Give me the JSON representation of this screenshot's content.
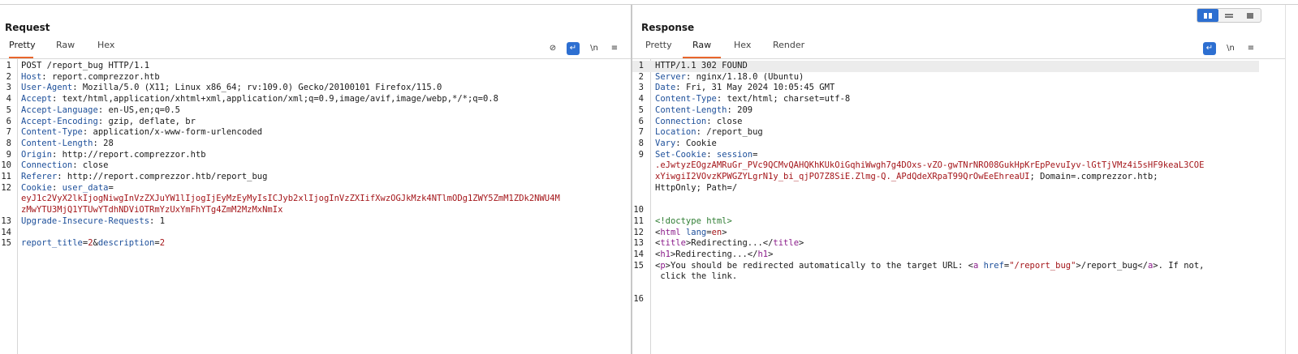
{
  "request": {
    "title": "Request",
    "tabs": [
      "Pretty",
      "Raw",
      "Hex"
    ],
    "active_tab": "Pretty",
    "tools": {
      "hide_label": "⊘",
      "wrap_label": "↵",
      "newline_label": "\\n",
      "menu_label": "≡"
    },
    "lines": [
      {
        "n": "1",
        "parts": [
          {
            "c": "plain",
            "t": "POST /report_bug HTTP/1.1"
          }
        ]
      },
      {
        "n": "2",
        "parts": [
          {
            "c": "k",
            "t": "Host"
          },
          {
            "c": "plain",
            "t": ": report.comprezzor.htb"
          }
        ]
      },
      {
        "n": "3",
        "parts": [
          {
            "c": "k",
            "t": "User-Agent"
          },
          {
            "c": "plain",
            "t": ": Mozilla/5.0 (X11; Linux x86_64; rv:109.0) Gecko/20100101 Firefox/115.0"
          }
        ]
      },
      {
        "n": "4",
        "parts": [
          {
            "c": "k",
            "t": "Accept"
          },
          {
            "c": "plain",
            "t": ": text/html,application/xhtml+xml,application/xml;q=0.9,image/avif,image/webp,*/*;q=0.8"
          }
        ]
      },
      {
        "n": "5",
        "parts": [
          {
            "c": "k",
            "t": "Accept-Language"
          },
          {
            "c": "plain",
            "t": ": en-US,en;q=0.5"
          }
        ]
      },
      {
        "n": "6",
        "parts": [
          {
            "c": "k",
            "t": "Accept-Encoding"
          },
          {
            "c": "plain",
            "t": ": gzip, deflate, br"
          }
        ]
      },
      {
        "n": "7",
        "parts": [
          {
            "c": "k",
            "t": "Content-Type"
          },
          {
            "c": "plain",
            "t": ": application/x-www-form-urlencoded"
          }
        ]
      },
      {
        "n": "8",
        "parts": [
          {
            "c": "k",
            "t": "Content-Length"
          },
          {
            "c": "plain",
            "t": ": 28"
          }
        ]
      },
      {
        "n": "9",
        "parts": [
          {
            "c": "k",
            "t": "Origin"
          },
          {
            "c": "plain",
            "t": ": http://report.comprezzor.htb"
          }
        ]
      },
      {
        "n": "10",
        "parts": [
          {
            "c": "k",
            "t": "Connection"
          },
          {
            "c": "plain",
            "t": ": close"
          }
        ]
      },
      {
        "n": "11",
        "parts": [
          {
            "c": "k",
            "t": "Referer"
          },
          {
            "c": "plain",
            "t": ": http://report.comprezzor.htb/report_bug"
          }
        ]
      },
      {
        "n": "12",
        "parts": [
          {
            "c": "k",
            "t": "Cookie"
          },
          {
            "c": "plain",
            "t": ": "
          },
          {
            "c": "k",
            "t": "user_data"
          },
          {
            "c": "plain",
            "t": "="
          }
        ]
      },
      {
        "n": "",
        "parts": [
          {
            "c": "v",
            "t": "eyJ1c2VyX2lkIjogNiwgInVzZXJuYW1lIjogIjEyMzEyMyIsICJyb2xlIjogInVzZXIifXwzOGJkMzk4NTlmODg1ZWY5ZmM1ZDk2NWU4M"
          }
        ]
      },
      {
        "n": "",
        "parts": [
          {
            "c": "v",
            "t": "zMwYTU3MjQ1YTUwYTdhNDViOTRmYzUxYmFhYTg4ZmM2MzMxNmIx"
          }
        ]
      },
      {
        "n": "13",
        "parts": [
          {
            "c": "k",
            "t": "Upgrade-Insecure-Requests"
          },
          {
            "c": "plain",
            "t": ": 1"
          }
        ]
      },
      {
        "n": "14",
        "parts": []
      },
      {
        "n": "15",
        "parts": [
          {
            "c": "k",
            "t": "report_title"
          },
          {
            "c": "plain",
            "t": "="
          },
          {
            "c": "v",
            "t": "2"
          },
          {
            "c": "plain",
            "t": "&"
          },
          {
            "c": "k",
            "t": "description"
          },
          {
            "c": "plain",
            "t": "="
          },
          {
            "c": "v",
            "t": "2"
          }
        ]
      }
    ]
  },
  "response": {
    "title": "Response",
    "tabs": [
      "Pretty",
      "Raw",
      "Hex",
      "Render"
    ],
    "active_tab": "Raw",
    "tools": {
      "wrap_label": "↵",
      "newline_label": "\\n",
      "menu_label": "≡"
    },
    "lines": [
      {
        "n": "1",
        "parts": [
          {
            "c": "plain",
            "t": "HTTP/1.1 302 FOUND"
          }
        ]
      },
      {
        "n": "2",
        "parts": [
          {
            "c": "k",
            "t": "Server"
          },
          {
            "c": "plain",
            "t": ": nginx/1.18.0 (Ubuntu)"
          }
        ]
      },
      {
        "n": "3",
        "parts": [
          {
            "c": "k",
            "t": "Date"
          },
          {
            "c": "plain",
            "t": ": Fri, 31 May 2024 10:05:45 GMT"
          }
        ]
      },
      {
        "n": "4",
        "parts": [
          {
            "c": "k",
            "t": "Content-Type"
          },
          {
            "c": "plain",
            "t": ": text/html; charset=utf-8"
          }
        ]
      },
      {
        "n": "5",
        "parts": [
          {
            "c": "k",
            "t": "Content-Length"
          },
          {
            "c": "plain",
            "t": ": 209"
          }
        ]
      },
      {
        "n": "6",
        "parts": [
          {
            "c": "k",
            "t": "Connection"
          },
          {
            "c": "plain",
            "t": ": close"
          }
        ]
      },
      {
        "n": "7",
        "parts": [
          {
            "c": "k",
            "t": "Location"
          },
          {
            "c": "plain",
            "t": ": /report_bug"
          }
        ]
      },
      {
        "n": "8",
        "parts": [
          {
            "c": "k",
            "t": "Vary"
          },
          {
            "c": "plain",
            "t": ": Cookie"
          }
        ]
      },
      {
        "n": "9",
        "parts": [
          {
            "c": "k",
            "t": "Set-Cookie"
          },
          {
            "c": "plain",
            "t": ": "
          },
          {
            "c": "k",
            "t": "session"
          },
          {
            "c": "plain",
            "t": "="
          }
        ]
      },
      {
        "n": "",
        "parts": [
          {
            "c": "v",
            "t": ".eJwtyzEOgzAMRuGr_PVc9QCMvQAHQKhKUkOiGqhiWwgh7g4DOxs-vZO-gwTNrNRO08GukHpKrEpPevuIyv-lGtTjVMz4i5sHF9keaL3COE"
          }
        ]
      },
      {
        "n": "",
        "parts": [
          {
            "c": "v",
            "t": "xYiwgiI2VOvzKPWGZYLgrN1y_bi_qjPO7Z8SiE.Zlmg-Q._APdQdeXRpaT99QrOwEeEhreaUI"
          },
          {
            "c": "plain",
            "t": "; Domain=.comprezzor.htb;"
          }
        ]
      },
      {
        "n": "",
        "parts": [
          {
            "c": "plain",
            "t": "HttpOnly; Path=/"
          }
        ]
      },
      {
        "n": "",
        "parts": []
      },
      {
        "n": "10",
        "parts": []
      },
      {
        "n": "11",
        "parts": [
          {
            "c": "c",
            "t": "<!doctype html>"
          }
        ]
      },
      {
        "n": "12",
        "parts": [
          {
            "c": "plain",
            "t": "<"
          },
          {
            "c": "t",
            "t": "html"
          },
          {
            "c": "plain",
            "t": " "
          },
          {
            "c": "a",
            "t": "lang"
          },
          {
            "c": "plain",
            "t": "="
          },
          {
            "c": "s",
            "t": "en"
          },
          {
            "c": "plain",
            "t": ">"
          }
        ]
      },
      {
        "n": "13",
        "parts": [
          {
            "c": "plain",
            "t": "<"
          },
          {
            "c": "t",
            "t": "title"
          },
          {
            "c": "plain",
            "t": ">Redirecting...</"
          },
          {
            "c": "t",
            "t": "title"
          },
          {
            "c": "plain",
            "t": ">"
          }
        ]
      },
      {
        "n": "14",
        "parts": [
          {
            "c": "plain",
            "t": "<"
          },
          {
            "c": "t",
            "t": "h1"
          },
          {
            "c": "plain",
            "t": ">Redirecting...</"
          },
          {
            "c": "t",
            "t": "h1"
          },
          {
            "c": "plain",
            "t": ">"
          }
        ]
      },
      {
        "n": "15",
        "parts": [
          {
            "c": "plain",
            "t": "<"
          },
          {
            "c": "t",
            "t": "p"
          },
          {
            "c": "plain",
            "t": ">You should be redirected automatically to the target URL: <"
          },
          {
            "c": "t",
            "t": "a"
          },
          {
            "c": "plain",
            "t": " "
          },
          {
            "c": "a",
            "t": "href"
          },
          {
            "c": "plain",
            "t": "="
          },
          {
            "c": "s",
            "t": "\"/report_bug\""
          },
          {
            "c": "plain",
            "t": ">/report_bug</"
          },
          {
            "c": "t",
            "t": "a"
          },
          {
            "c": "plain",
            "t": ">. If not,"
          }
        ]
      },
      {
        "n": "",
        "parts": [
          {
            "c": "plain",
            "t": " click the link."
          }
        ]
      },
      {
        "n": "",
        "parts": []
      },
      {
        "n": "16",
        "parts": []
      }
    ]
  },
  "layout_toggle": {
    "options": [
      "split-horizontal",
      "split-vertical",
      "single"
    ],
    "active": "split-horizontal"
  },
  "colors": {
    "accent": "#2d6fd1",
    "tab_underline": "#e8662c",
    "header_name": "#1d4f9a",
    "value_red": "#a4161a"
  }
}
